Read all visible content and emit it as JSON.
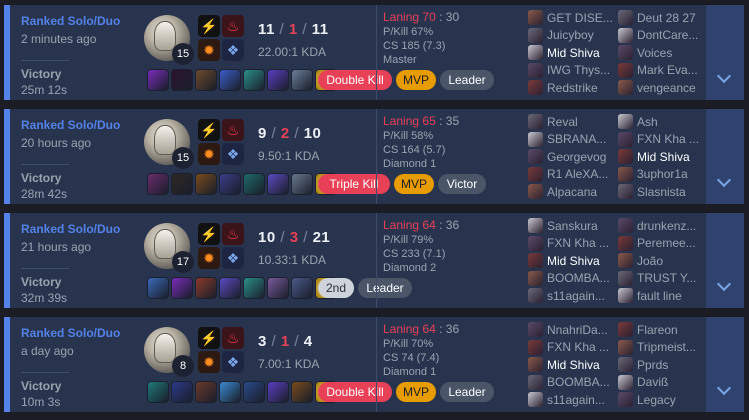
{
  "matches": [
    {
      "queue": "Ranked Solo/Duo",
      "time_ago": "2 minutes ago",
      "result": "Victory",
      "duration": "25m 12s",
      "champion_level": "15",
      "kills": "11",
      "deaths": "1",
      "assists": "11",
      "kda_ratio": "22.00:1 KDA",
      "tags": [
        "Double Kill",
        "MVP",
        "Leader"
      ],
      "laning_label": "Laning",
      "laning_left": "70",
      "laning_right": "30",
      "pkill": "P/Kill 67%",
      "cs": "CS 185 (7.3)",
      "rank": "Master",
      "team1": [
        "GET DISE...",
        "Juicyboy",
        "Mid Shiva",
        "IWG Thys...",
        "Redstrike"
      ],
      "team2": [
        "Deut 28 27",
        "DontCare...",
        "Voices",
        "Mark Eva...",
        "vengeance"
      ],
      "me_team": 1,
      "me_index": 2
    },
    {
      "queue": "Ranked Solo/Duo",
      "time_ago": "20 hours ago",
      "result": "Victory",
      "duration": "28m 42s",
      "champion_level": "15",
      "kills": "9",
      "deaths": "2",
      "assists": "10",
      "kda_ratio": "9.50:1 KDA",
      "tags": [
        "Triple Kill",
        "MVP",
        "Victor"
      ],
      "laning_label": "Laning",
      "laning_left": "65",
      "laning_right": "35",
      "pkill": "P/Kill 58%",
      "cs": "CS 164 (5.7)",
      "rank": "Diamond 1",
      "team1": [
        "Reval",
        "SBRANA...",
        "Georgevog",
        "R1 AleXA...",
        "Alpacana"
      ],
      "team2": [
        "Ash",
        "FXN Kha ...",
        "Mid Shiva",
        "3uphor1a",
        "Slasnista"
      ],
      "me_team": 2,
      "me_index": 2
    },
    {
      "queue": "Ranked Solo/Duo",
      "time_ago": "21 hours ago",
      "result": "Victory",
      "duration": "32m 39s",
      "champion_level": "17",
      "kills": "10",
      "deaths": "3",
      "assists": "21",
      "kda_ratio": "10.33:1 KDA",
      "tags": [
        "2nd",
        "Leader"
      ],
      "laning_label": "Laning",
      "laning_left": "64",
      "laning_right": "36",
      "pkill": "P/Kill 79%",
      "cs": "CS 233 (7.1)",
      "rank": "Diamond 2",
      "team1": [
        "Sanskura",
        "FXN Kha ...",
        "Mid Shiva",
        "BOOMBA...",
        "s11again..."
      ],
      "team2": [
        "drunkenz...",
        "Peremee...",
        "João",
        "TRUST Y...",
        "fault line"
      ],
      "me_team": 1,
      "me_index": 2
    },
    {
      "queue": "Ranked Solo/Duo",
      "time_ago": "a day ago",
      "result": "Victory",
      "duration": "10m 3s",
      "champion_level": "8",
      "kills": "3",
      "deaths": "1",
      "assists": "4",
      "kda_ratio": "7.00:1 KDA",
      "tags": [
        "Double Kill",
        "MVP",
        "Leader"
      ],
      "laning_label": "Laning",
      "laning_left": "64",
      "laning_right": "36",
      "pkill": "P/Kill 70%",
      "cs": "CS 74 (7.4)",
      "rank": "Diamond 1",
      "team1": [
        "NnahriDa...",
        "FXN Kha ...",
        "Mid Shiva",
        "BOOMBA...",
        "s11again..."
      ],
      "team2": [
        "Flareon",
        "Tripmeist...",
        "Pprds",
        "Daviß",
        "Legacy"
      ],
      "me_team": 1,
      "me_index": 2
    }
  ],
  "icons": {
    "spell_top_left": "flash-icon",
    "spell_top_right": "ignite-icon",
    "rune_primary": "electrocute-rune-icon",
    "rune_secondary": "sorcery-rune-icon",
    "expand": "chevron-down-icon"
  },
  "colors": {
    "accent": "#5383e8",
    "death": "#e84057",
    "mvp": "#e89c04",
    "card": "#28344e"
  }
}
